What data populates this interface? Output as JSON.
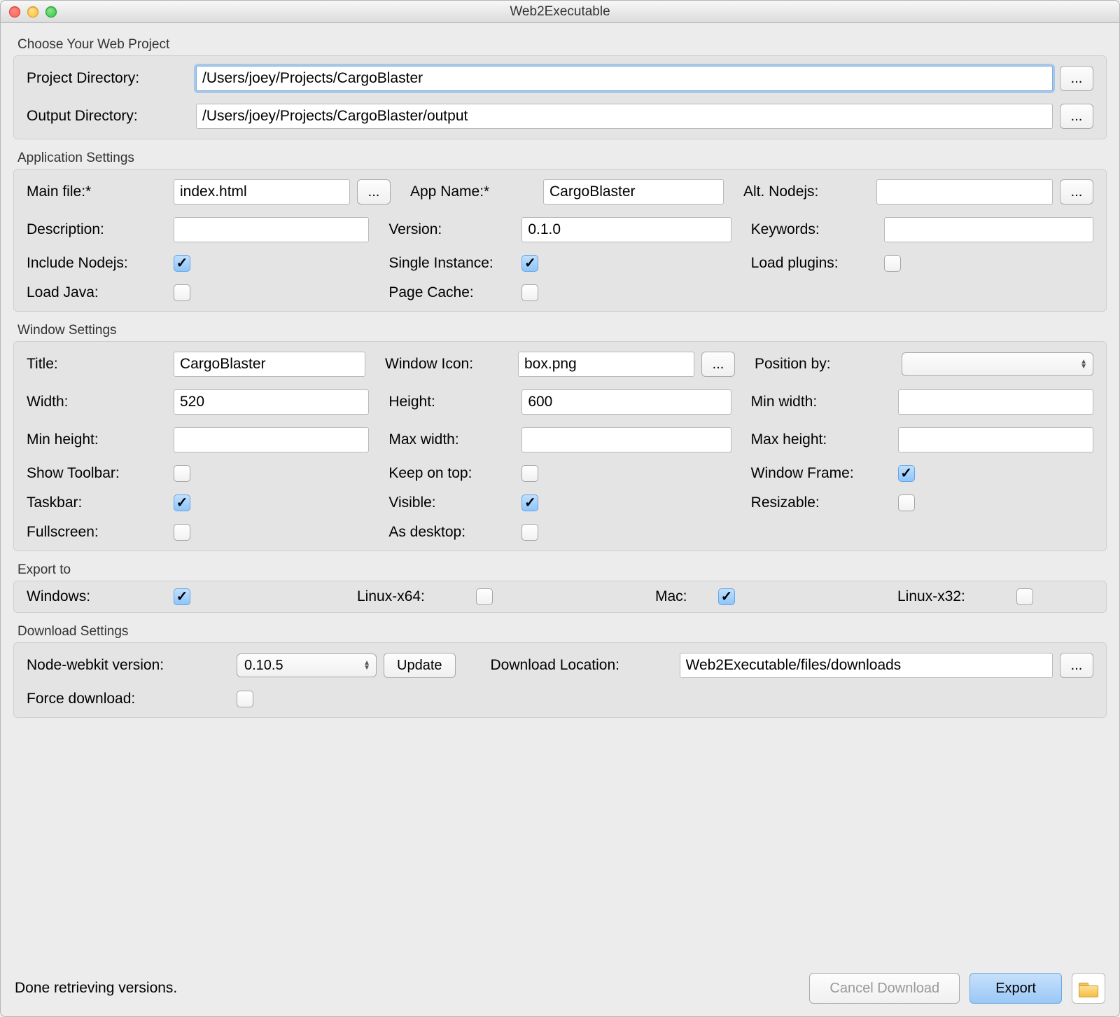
{
  "window_title": "Web2Executable",
  "groups": {
    "project": {
      "title": "Choose Your Web Project",
      "project_dir_label": "Project Directory:",
      "project_dir_value": "/Users/joey/Projects/CargoBlaster",
      "output_dir_label": "Output Directory:",
      "output_dir_value": "/Users/joey/Projects/CargoBlaster/output",
      "browse": "..."
    },
    "app": {
      "title": "Application Settings",
      "main_file_label": "Main file:*",
      "main_file_value": "index.html",
      "app_name_label": "App Name:*",
      "app_name_value": "CargoBlaster",
      "alt_nodejs_label": "Alt. Nodejs:",
      "alt_nodejs_value": "",
      "description_label": "Description:",
      "description_value": "",
      "version_label": "Version:",
      "version_value": "0.1.0",
      "keywords_label": "Keywords:",
      "keywords_value": "",
      "include_nodejs_label": "Include Nodejs:",
      "include_nodejs_checked": true,
      "single_instance_label": "Single Instance:",
      "single_instance_checked": true,
      "load_plugins_label": "Load plugins:",
      "load_plugins_checked": false,
      "load_java_label": "Load Java:",
      "load_java_checked": false,
      "page_cache_label": "Page Cache:",
      "page_cache_checked": false,
      "browse": "..."
    },
    "window": {
      "title": "Window Settings",
      "title_label": "Title:",
      "title_value": "CargoBlaster",
      "window_icon_label": "Window Icon:",
      "window_icon_value": "box.png",
      "position_by_label": "Position by:",
      "position_by_value": "",
      "width_label": "Width:",
      "width_value": "520",
      "height_label": "Height:",
      "height_value": "600",
      "min_width_label": "Min width:",
      "min_width_value": "",
      "min_height_label": "Min height:",
      "min_height_value": "",
      "max_width_label": "Max width:",
      "max_width_value": "",
      "max_height_label": "Max height:",
      "max_height_value": "",
      "show_toolbar_label": "Show Toolbar:",
      "show_toolbar_checked": false,
      "keep_on_top_label": "Keep on top:",
      "keep_on_top_checked": false,
      "window_frame_label": "Window Frame:",
      "window_frame_checked": true,
      "taskbar_label": "Taskbar:",
      "taskbar_checked": true,
      "visible_label": "Visible:",
      "visible_checked": true,
      "resizable_label": "Resizable:",
      "resizable_checked": false,
      "fullscreen_label": "Fullscreen:",
      "fullscreen_checked": false,
      "as_desktop_label": "As desktop:",
      "as_desktop_checked": false,
      "browse": "..."
    },
    "export": {
      "title": "Export to",
      "windows_label": "Windows:",
      "windows_checked": true,
      "linux_x64_label": "Linux-x64:",
      "linux_x64_checked": false,
      "mac_label": "Mac:",
      "mac_checked": true,
      "linux_x32_label": "Linux-x32:",
      "linux_x32_checked": false
    },
    "download": {
      "title": "Download Settings",
      "nw_version_label": "Node-webkit version:",
      "nw_version_value": "0.10.5",
      "update_label": "Update",
      "download_location_label": "Download Location:",
      "download_location_value": "Web2Executable/files/downloads",
      "force_download_label": "Force download:",
      "force_download_checked": false,
      "browse": "..."
    }
  },
  "footer": {
    "status": "Done retrieving versions.",
    "cancel_label": "Cancel Download",
    "export_label": "Export"
  }
}
